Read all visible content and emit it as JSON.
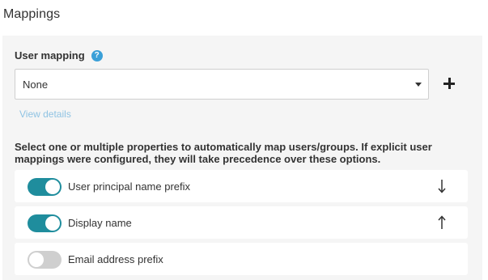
{
  "section": {
    "title": "Mappings"
  },
  "user_mapping": {
    "label": "User mapping",
    "help_icon": "question-circle-icon",
    "selected_value": "None",
    "add_icon": "plus-icon",
    "view_details_label": "View details"
  },
  "description": "Select one or multiple properties to automatically map users/groups. If explicit user mappings were configured, they will take precedence over these options.",
  "properties": [
    {
      "label": "User principal name prefix",
      "enabled": true,
      "arrow_icon": "arrow-down-icon"
    },
    {
      "label": "Display name",
      "enabled": true,
      "arrow_icon": "arrow-up-icon"
    },
    {
      "label": "Email address prefix",
      "enabled": false,
      "arrow_icon": ""
    }
  ],
  "colors": {
    "toggle_on": "#1f8d9d",
    "toggle_off": "#cfcfcf",
    "help_icon": "#3aa0d8",
    "link": "#8fc3e3",
    "panel_background": "#f5f5f5"
  }
}
